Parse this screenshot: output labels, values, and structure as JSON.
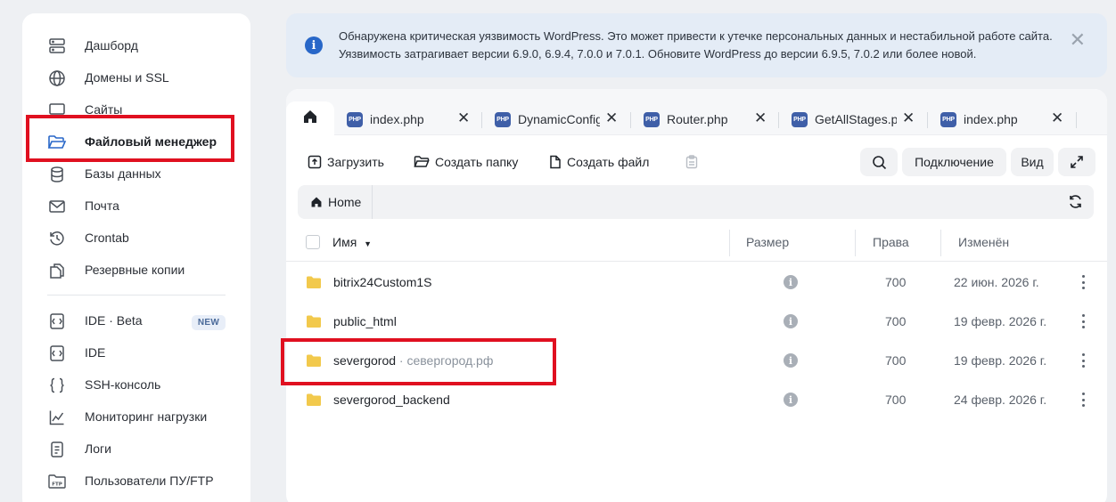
{
  "sidebar": {
    "items": [
      {
        "label": "Дашборд",
        "icon": "server-icon"
      },
      {
        "label": "Домены и SSL",
        "icon": "globe-icon"
      },
      {
        "label": "Сайты",
        "icon": "monitor-icon"
      },
      {
        "label": "Файловый менеджер",
        "icon": "folder-open-icon",
        "active": true
      },
      {
        "label": "Базы данных",
        "icon": "database-icon"
      },
      {
        "label": "Почта",
        "icon": "mail-icon"
      },
      {
        "label": "Crontab",
        "icon": "history-icon"
      },
      {
        "label": "Резервные копии",
        "icon": "copy-icon"
      },
      {
        "label": "IDE · Beta",
        "icon": "ide-icon",
        "badge": "NEW"
      },
      {
        "label": "IDE",
        "icon": "ide-icon"
      },
      {
        "label": "SSH-консоль",
        "icon": "braces-icon"
      },
      {
        "label": "Мониторинг нагрузки",
        "icon": "chart-line-icon"
      },
      {
        "label": "Логи",
        "icon": "log-file-icon"
      },
      {
        "label": "Пользователи ПУ/FTP",
        "icon": "ftp-folder-icon"
      }
    ]
  },
  "alert": {
    "text": "Обнаружена критическая уязвимость WordPress. Это может привести к утечке персональных данных и нестабильной работе сайта. Уязвимость затрагивает версии 6.9.0, 6.9.4, 7.0.0 и 7.0.1. Обновите WordPress до версии 6.9.5, 7.0.2 или более новой.",
    "close": "✕"
  },
  "tabs": [
    {
      "name": "index.php",
      "badge": "PHP"
    },
    {
      "name": "DynamicConfig",
      "badge": "PHP"
    },
    {
      "name": "Router.php",
      "badge": "PHP"
    },
    {
      "name": "GetAllStages.p",
      "badge": "PHP"
    },
    {
      "name": "index.php",
      "badge": "PHP"
    }
  ],
  "toolbar": {
    "upload": "Загрузить",
    "create_folder": "Создать папку",
    "create_file": "Создать файл",
    "connect": "Подключение",
    "view": "Вид"
  },
  "breadcrumb": {
    "home": "Home"
  },
  "table": {
    "headers": {
      "name": "Имя",
      "size": "Размер",
      "perms": "Права",
      "modified": "Изменён"
    },
    "rows": [
      {
        "name": "bitrix24Custom1S",
        "domain": "",
        "perms": "700",
        "modified": "22 июн. 2026 г."
      },
      {
        "name": "public_html",
        "domain": "",
        "perms": "700",
        "modified": "19 февр. 2026 г."
      },
      {
        "name": "severgorod",
        "domain": " · севергород.рф",
        "perms": "700",
        "modified": "19 февр. 2026 г."
      },
      {
        "name": "severgorod_backend",
        "domain": "",
        "perms": "700",
        "modified": "24 февр. 2026 г."
      }
    ]
  },
  "colors": {
    "accent": "#2867c8",
    "highlight": "#e01020",
    "folder": "#f2c94c"
  }
}
